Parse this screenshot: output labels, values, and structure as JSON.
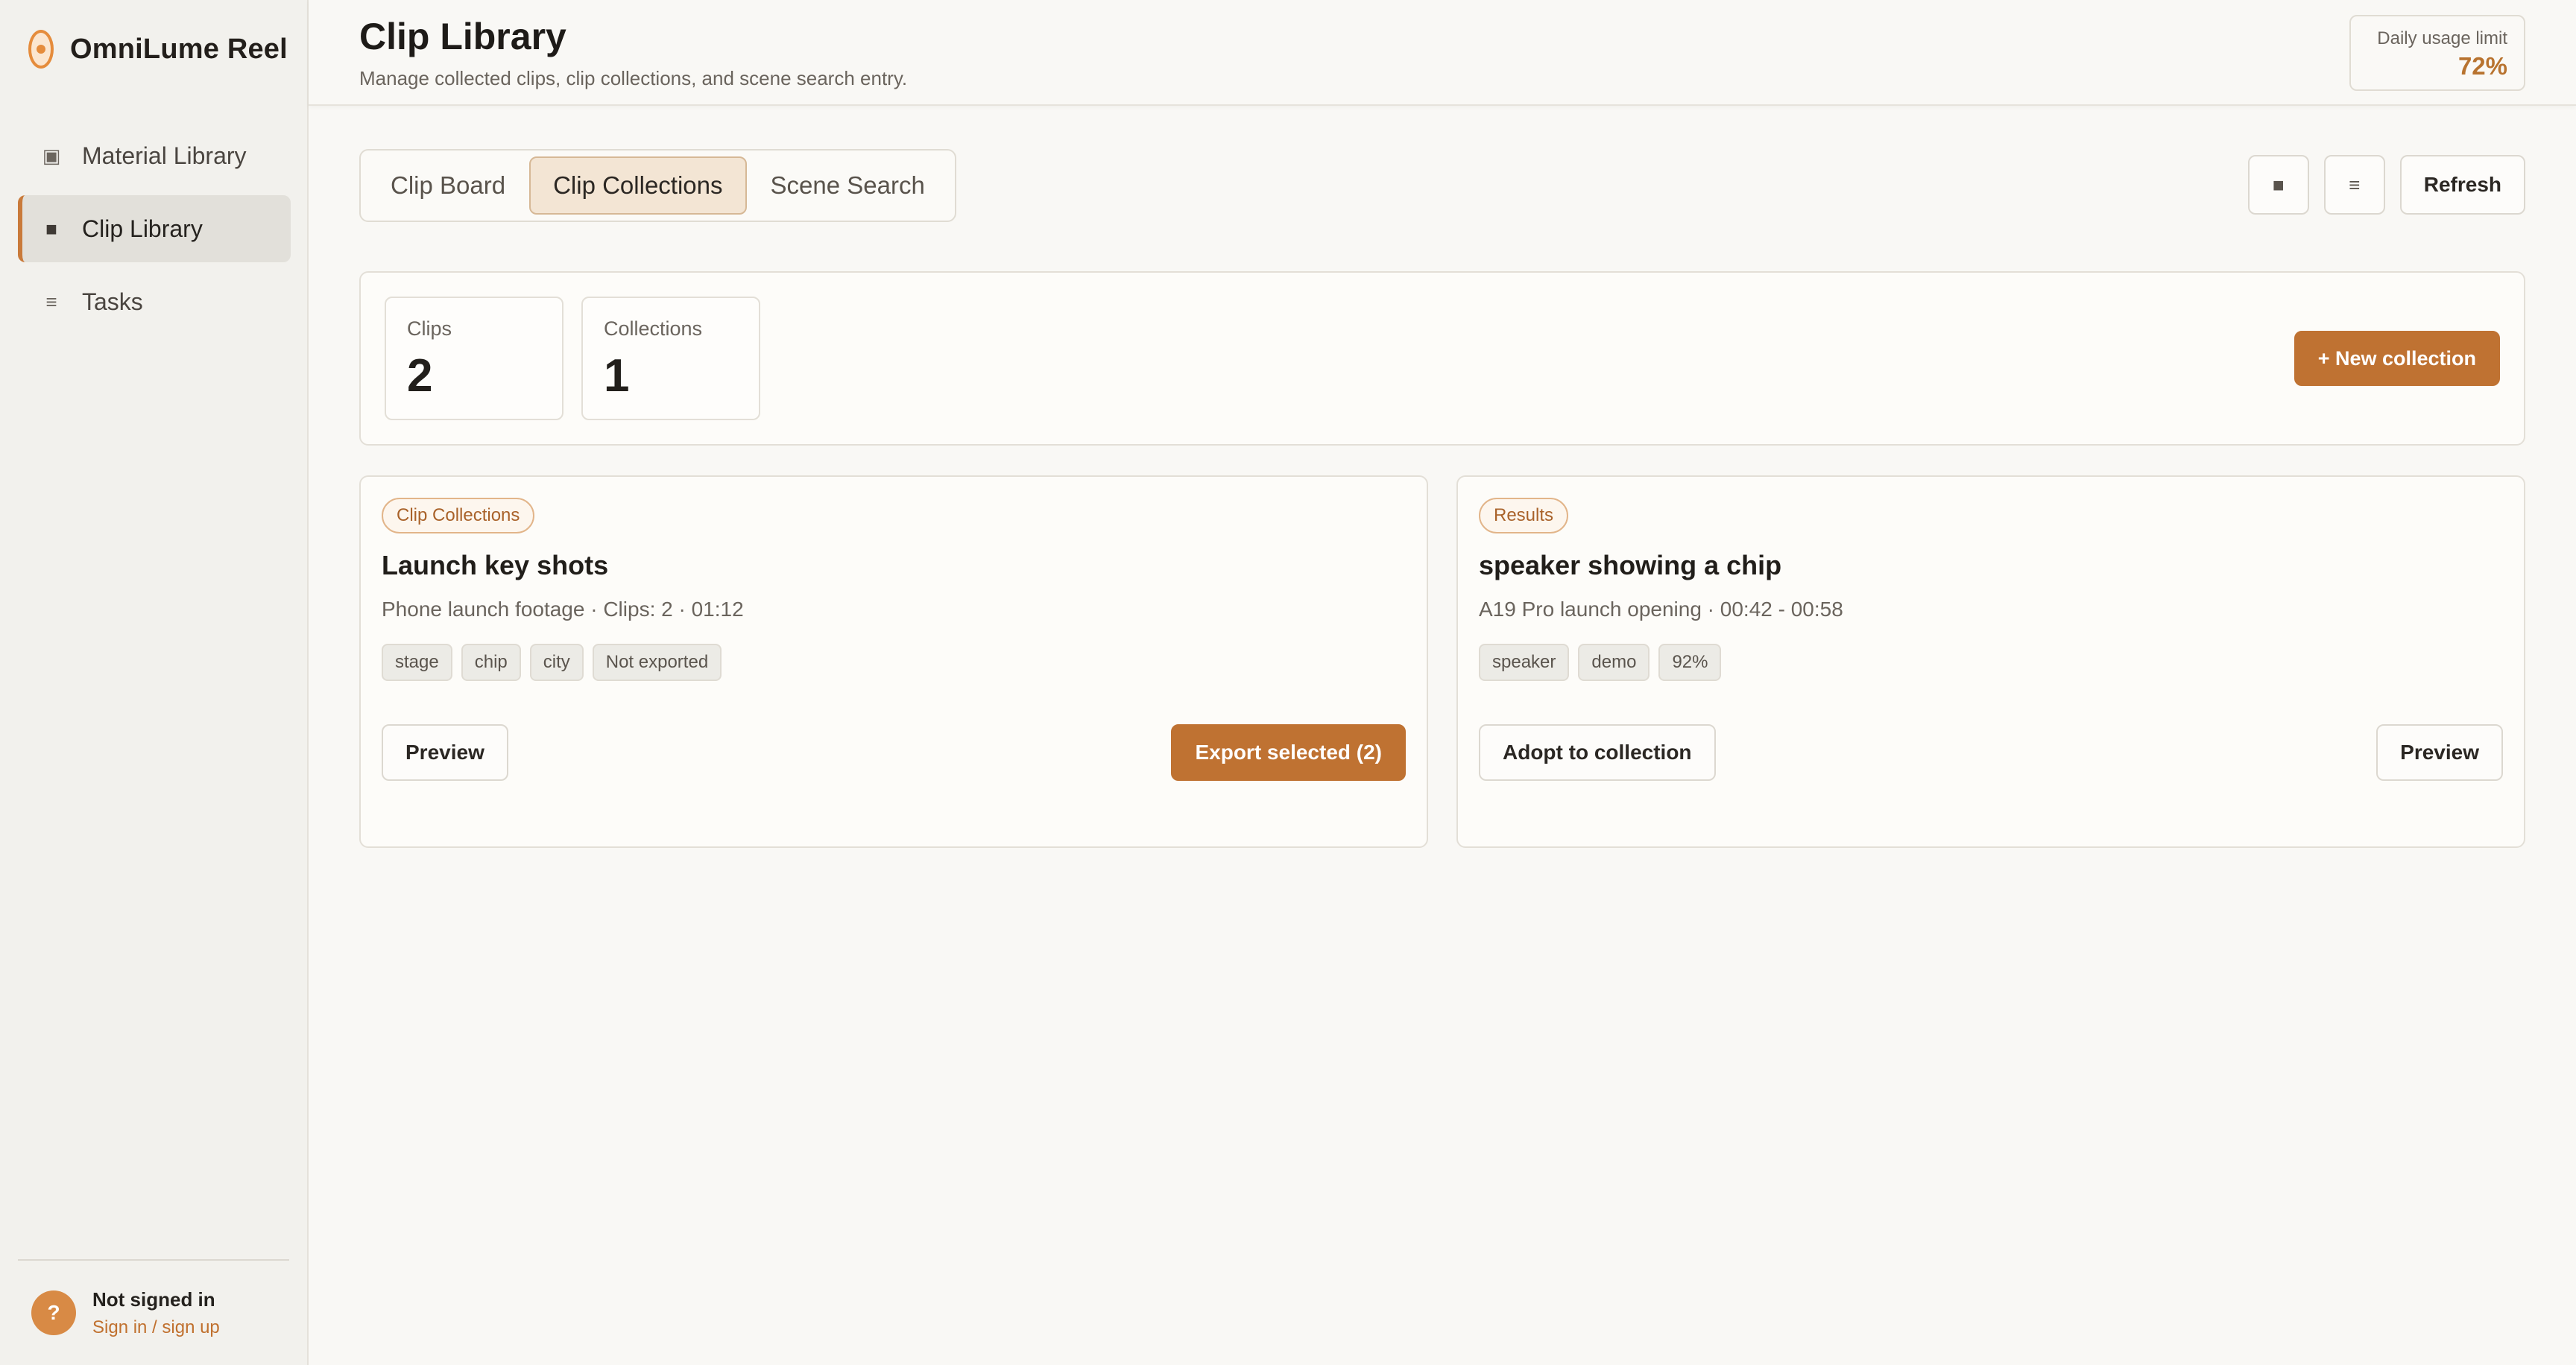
{
  "app": {
    "name": "OmniLume Reel"
  },
  "sidebar": {
    "items": [
      {
        "label": "Material Library",
        "icon": "▣"
      },
      {
        "label": "Clip Library",
        "icon": "■"
      },
      {
        "label": "Tasks",
        "icon": "≡"
      }
    ],
    "footer": {
      "avatar": "?",
      "user": "Not signed in",
      "link": "Sign in / sign up"
    }
  },
  "header": {
    "title": "Clip Library",
    "subtitle": "Manage collected clips, clip collections, and scene search entry.",
    "usage_label": "Daily usage limit",
    "usage_value": "72%"
  },
  "tabs": [
    "Clip Board",
    "Clip Collections",
    "Scene Search"
  ],
  "toolbar": {
    "grid_icon": "■",
    "list_icon": "≡",
    "refresh": "Refresh"
  },
  "stats": {
    "clips_label": "Clips",
    "clips_value": "2",
    "collections_label": "Collections",
    "collections_value": "1",
    "new_collection": "+ New collection"
  },
  "cards": [
    {
      "badge": "Clip Collections",
      "title": "Launch key shots",
      "meta": "Phone launch footage · Clips: 2 · 01:12",
      "tags": [
        "stage",
        "chip",
        "city",
        "Not exported"
      ],
      "left_action": "Preview",
      "right_action": "Export selected (2)"
    },
    {
      "badge": "Results",
      "title": "speaker showing a chip",
      "meta": "A19 Pro launch opening · 00:42 - 00:58",
      "tags": [
        "speaker",
        "demo",
        "92%"
      ],
      "left_action": "Adopt to collection",
      "right_action": "Preview"
    }
  ],
  "colors": {
    "accent": "#bf7232",
    "usage_value": "#b8732f",
    "logo": "#e58c3c"
  }
}
